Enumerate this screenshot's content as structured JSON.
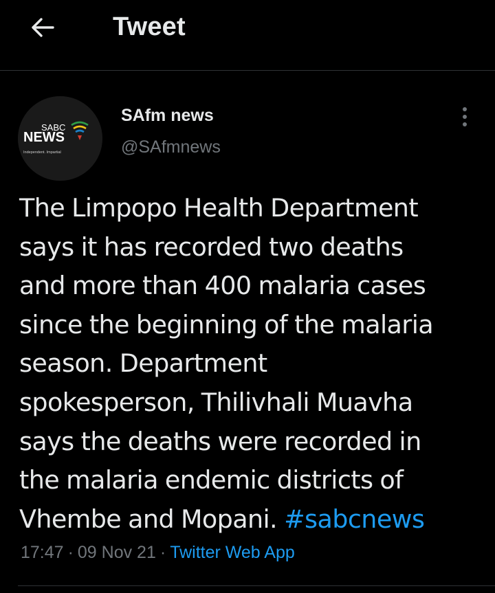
{
  "header": {
    "title": "Tweet",
    "back_icon": "arrow-left-icon"
  },
  "author": {
    "display_name": "SAfm news",
    "handle": "@SAfmnews",
    "avatar": {
      "logo_top": "SABC",
      "logo_main": "NEWS",
      "logo_tagline": "Independent. Impartial"
    },
    "more_icon": "more-vertical-icon"
  },
  "tweet": {
    "lines": [
      "The Limpopo Health Department",
      "says it has recorded two deaths",
      "and more than 400 malaria cases",
      "since the beginning of the malaria",
      "season. Department",
      "spokesperson, Thilivhali Muavha",
      "says the deaths were recorded in",
      "the malaria endemic districts of",
      "Vhembe and Mopani."
    ],
    "hashtag": "#sabcnews"
  },
  "meta": {
    "time": "17:47",
    "separator": "·",
    "date": "09 Nov 21",
    "source": "Twitter Web App"
  },
  "colors": {
    "background": "#000000",
    "text": "#e7e9ea",
    "secondary": "#71767b",
    "accent": "#1d9bf0",
    "divider": "#2f3336"
  }
}
